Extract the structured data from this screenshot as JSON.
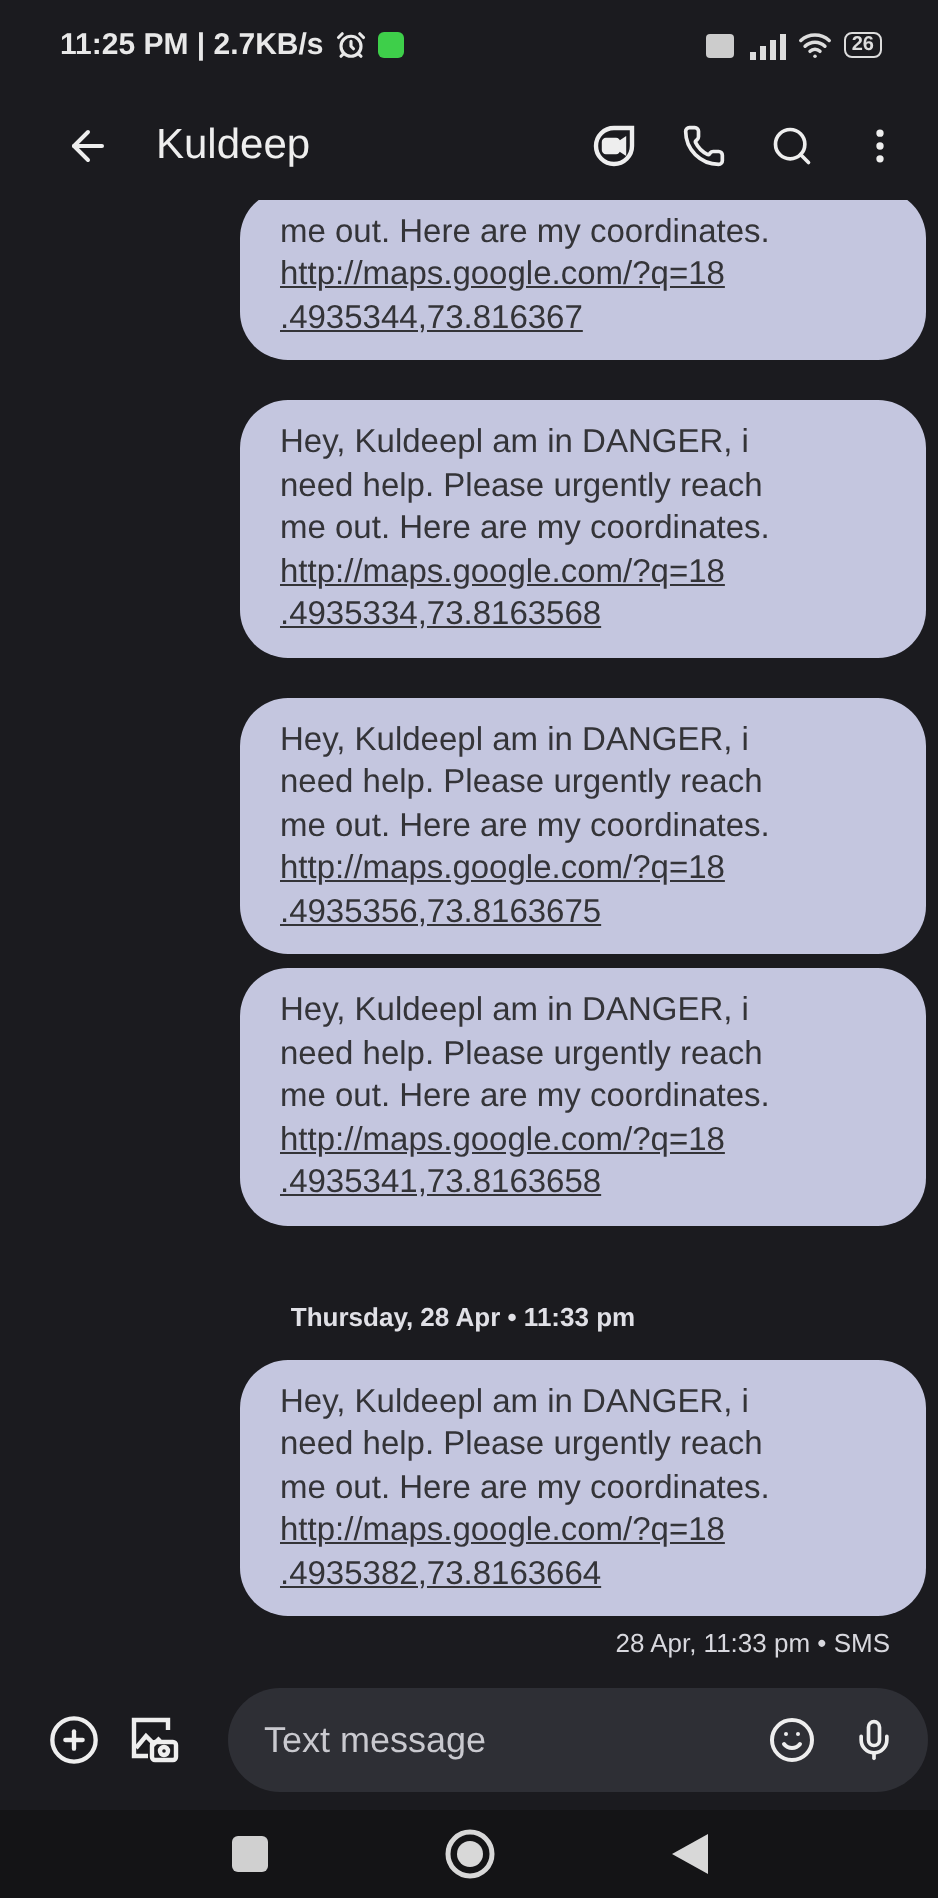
{
  "status_bar": {
    "time": "11:25 PM | 2.7KB/s",
    "battery": "26"
  },
  "header": {
    "title": "Kuldeep"
  },
  "messages": [
    {
      "kind": "bubble",
      "text": "me out. Here are my coordinates.",
      "link_lines": [
        "http://maps.google.com/?q=18",
        ".4935344,73.816367"
      ]
    },
    {
      "kind": "bubble",
      "text": "Hey, Kuldeepl am in DANGER, i\nneed help. Please urgently reach\nme out. Here are my coordinates.",
      "link_lines": [
        "http://maps.google.com/?q=18",
        ".4935334,73.8163568"
      ]
    },
    {
      "kind": "bubble",
      "text": "Hey, Kuldeepl am in DANGER, i\nneed help. Please urgently reach\nme out. Here are my coordinates.",
      "link_lines": [
        "http://maps.google.com/?q=18",
        ".4935356,73.8163675"
      ]
    },
    {
      "kind": "bubble",
      "text": "Hey, Kuldeepl am in DANGER, i\nneed help. Please urgently reach\nme out. Here are my coordinates.",
      "link_lines": [
        "http://maps.google.com/?q=18",
        ".4935341,73.8163658"
      ]
    },
    {
      "kind": "separator",
      "text": "Thursday, 28 Apr • 11:33 pm"
    },
    {
      "kind": "bubble",
      "text": "Hey, Kuldeepl am in DANGER, i\nneed help. Please urgently reach\nme out. Here are my coordinates.",
      "link_lines": [
        "http://maps.google.com/?q=18",
        ".4935382,73.8163664"
      ]
    },
    {
      "kind": "meta",
      "text": "28 Apr, 11:33 pm • SMS"
    }
  ],
  "composer": {
    "placeholder": "Text message"
  }
}
